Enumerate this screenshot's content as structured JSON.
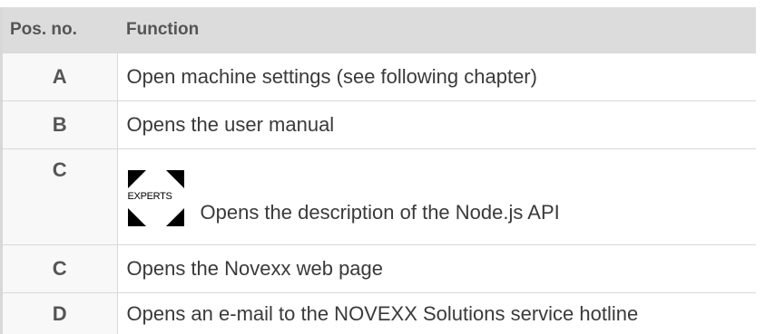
{
  "table": {
    "header": {
      "pos_no": "Pos. no.",
      "function": "Function"
    },
    "rows": [
      {
        "pos": "A",
        "function": "Open machine settings (see following chapter)"
      },
      {
        "pos": "B",
        "function": "Opens the user manual"
      },
      {
        "pos": "C",
        "function": "Opens the description of the Node.js API",
        "icon": "experts-logo-icon",
        "icon_text": "EXPERTS"
      },
      {
        "pos": "C",
        "function": "Opens the Novexx web page"
      },
      {
        "pos": "D",
        "function": "Opens an e-mail to the NOVEXX Solutions service hotline"
      }
    ]
  },
  "colors": {
    "header_bg": "#dcdcdc",
    "pos_cell_bg": "#f8f8f8",
    "border": "#d8d8d8",
    "text": "#3a3a3a"
  }
}
